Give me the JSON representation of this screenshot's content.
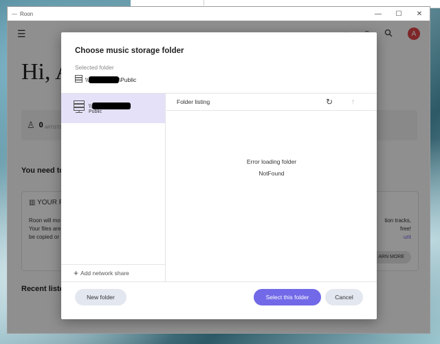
{
  "window": {
    "title": "Roon",
    "minimize": "—",
    "maximize": "☐",
    "close": "✕"
  },
  "background_app": {
    "greeting": "Hi, A",
    "stats_count": "0",
    "stats_label": "ARTISTS",
    "need_heading": "You need to",
    "card_heading": "YOUR F",
    "card_lines": [
      "Roon will mo",
      "Your files are",
      "be copied or"
    ],
    "card_right_lines": [
      "tion tracks,",
      "free!",
      "unt"
    ],
    "learn_more": "ARN MORE",
    "recent_heading": "Recent liste",
    "avatar_letter": "A"
  },
  "dialog": {
    "title": "Choose music storage folder",
    "selected_label": "Selected folder",
    "selected_path_prefix": "\\\\",
    "selected_path_suffix": "\\Public",
    "location": {
      "prefix": "\\\\",
      "sub": "Public"
    },
    "add_share": "Add network share",
    "listing_header": "Folder listing",
    "error_title": "Error loading folder",
    "error_detail": "NotFound",
    "buttons": {
      "new": "New folder",
      "select": "Select this folder",
      "cancel": "Cancel"
    }
  },
  "icons": [
    "menu-icon",
    "bell-icon",
    "tablet-icon",
    "search-icon",
    "server-icon",
    "refresh-icon",
    "arrow-up-icon",
    "plus-icon"
  ],
  "colors": {
    "accent": "#7169e8",
    "selected_row": "#e4e1f8",
    "avatar": "#d94448"
  }
}
